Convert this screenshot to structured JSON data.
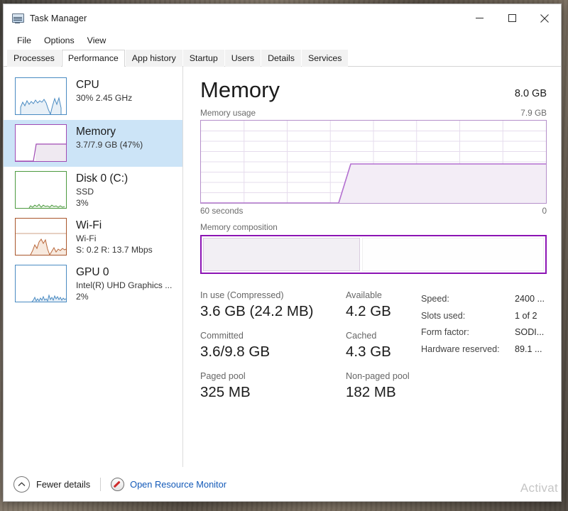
{
  "window": {
    "title": "Task Manager",
    "icon": "task-manager-icon",
    "controls": {
      "minimize": "─",
      "maximize": "□",
      "close": "✕"
    }
  },
  "menubar": {
    "items": [
      "File",
      "Options",
      "View"
    ]
  },
  "tabs": {
    "items": [
      "Processes",
      "Performance",
      "App history",
      "Startup",
      "Users",
      "Details",
      "Services"
    ],
    "active": "Performance"
  },
  "sidebar": {
    "items": [
      {
        "name": "CPU",
        "sub1": "30%  2.45 GHz",
        "sub2": "",
        "color": "#4a8bc2",
        "selected": false
      },
      {
        "name": "Memory",
        "sub1": "3.7/7.9 GB (47%)",
        "sub2": "",
        "color": "#a04bb4",
        "selected": true
      },
      {
        "name": "Disk 0 (C:)",
        "sub1": "SSD",
        "sub2": "3%",
        "color": "#4c9a3f",
        "selected": false
      },
      {
        "name": "Wi-Fi",
        "sub1": "Wi-Fi",
        "sub2": "S: 0.2 R: 13.7 Mbps",
        "color": "#a9562b",
        "selected": false
      },
      {
        "name": "GPU 0",
        "sub1": "Intel(R) UHD Graphics ...",
        "sub2": "2%",
        "color": "#4a8bc2",
        "selected": false
      }
    ]
  },
  "main": {
    "title": "Memory",
    "total": "8.0 GB",
    "graph_caption_left": "Memory usage",
    "graph_caption_right": "7.9 GB",
    "axis_left": "60 seconds",
    "axis_right": "0",
    "composition_caption": "Memory composition",
    "accent": "#8c14b4",
    "graph_line_color": "#b36fd0"
  },
  "stats": {
    "rows": [
      [
        {
          "label": "In use (Compressed)",
          "value": "3.6 GB (24.2 MB)"
        },
        {
          "label": "Available",
          "value": "4.2 GB"
        }
      ],
      [
        {
          "label": "Committed",
          "value": "3.6/9.8 GB"
        },
        {
          "label": "Cached",
          "value": "4.3 GB"
        }
      ],
      [
        {
          "label": "Paged pool",
          "value": "325 MB"
        },
        {
          "label": "Non-paged pool",
          "value": "182 MB"
        }
      ]
    ],
    "specs": [
      {
        "key": "Speed:",
        "value": "2400 ..."
      },
      {
        "key": "Slots used:",
        "value": "1 of 2"
      },
      {
        "key": "Form factor:",
        "value": "SODI..."
      },
      {
        "key": "Hardware reserved:",
        "value": "89.1 ..."
      }
    ]
  },
  "footer": {
    "fewer_details": "Fewer details",
    "open_resource_monitor": "Open Resource Monitor"
  },
  "watermark": "Activat",
  "chart_data": {
    "type": "area",
    "title": "Memory usage",
    "ylabel": "GB",
    "ylim": [
      0,
      7.9
    ],
    "xlabel": "seconds",
    "xlim": [
      60,
      0
    ],
    "grid": true,
    "x": [
      0,
      10,
      20,
      30,
      38,
      40,
      42,
      50,
      60
    ],
    "values": [
      0,
      0,
      0,
      0,
      0,
      1.9,
      3.7,
      3.7,
      3.7
    ],
    "current": 3.7,
    "composition": {
      "in_use_fraction": 0.46,
      "segments": [
        {
          "name": "In use",
          "fraction": 0.46
        },
        {
          "name": "Available",
          "fraction": 0.54
        }
      ]
    }
  }
}
